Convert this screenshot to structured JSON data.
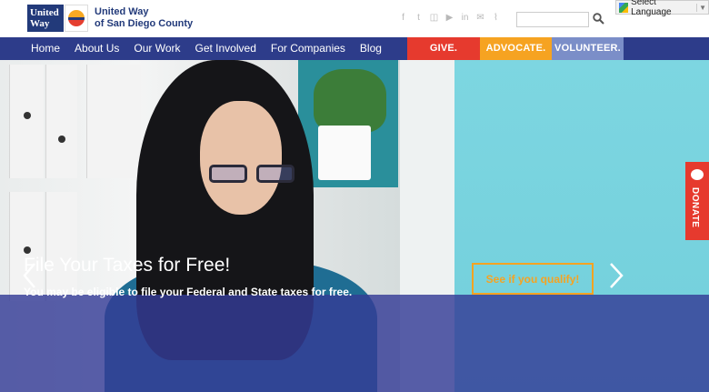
{
  "header": {
    "logo_text": "United Way",
    "org_name_line1": "United Way",
    "org_name_line2": "of San Diego County",
    "social_icons": [
      "facebook-icon",
      "twitter-icon",
      "instagram-icon",
      "youtube-icon",
      "linkedin-icon",
      "email-icon",
      "rss-icon"
    ],
    "search_placeholder": "",
    "language_label": "Select Language"
  },
  "nav": {
    "items": [
      "Home",
      "About Us",
      "Our Work",
      "Get Involved",
      "For Companies",
      "Blog"
    ],
    "cta": [
      "GIVE.",
      "ADVOCATE.",
      "VOLUNTEER."
    ]
  },
  "hero": {
    "title": "File Your Taxes for Free!",
    "subtitle": "You may be eligible to file your Federal and State taxes for free.",
    "button_label": "See if you qualify!"
  },
  "donate": {
    "label": "DONATE"
  },
  "colors": {
    "brand_blue": "#2d3c8a",
    "give_red": "#e63a2e",
    "advocate_orange": "#f6a321",
    "volunteer_lavender": "#7b8ec8"
  }
}
